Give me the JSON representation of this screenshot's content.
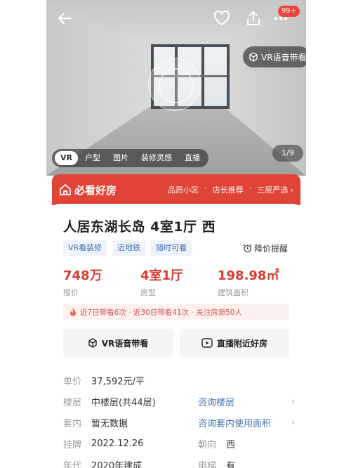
{
  "header": {
    "back_icon": "arrow-left-icon",
    "fav_icon": "heart-icon",
    "share_icon": "share-icon",
    "more_icon": "more-icon",
    "badge": "99+",
    "vr_voice": "VR语音带看",
    "tabs": [
      "VR",
      "户型",
      "图片",
      "装修灵感",
      "直播"
    ],
    "counter": "1/9"
  },
  "banner": {
    "brand": "必看好房",
    "tags": [
      "品质小区",
      "店长推荐",
      "三层严选 ›"
    ]
  },
  "listing": {
    "title": "人居东湖长岛 4室1厅 西",
    "chips": [
      "VR看装修",
      "近地铁",
      "随时可看"
    ],
    "price_alert": "降价提醒",
    "stats": [
      {
        "value": "748万",
        "label": "报价"
      },
      {
        "value": "4室1厅",
        "label": "房型"
      },
      {
        "value": "198.98㎡",
        "label": "建筑面积"
      }
    ],
    "hot": "近7日带看6次 · 近30日带看41次 · 关注房源50人",
    "actions": [
      "VR语音带看",
      "直播附近好房"
    ],
    "info": [
      {
        "k": "单价",
        "v": "37,592元/平",
        "k2": "",
        "v2": "",
        "link": false
      },
      {
        "k": "楼层",
        "v": "中楼层(共44层)",
        "k2": "",
        "v2": "咨询楼层",
        "link": true
      },
      {
        "k": "套内",
        "v": "暂无数据",
        "k2": "",
        "v2": "咨询套内使用面积",
        "link": true
      },
      {
        "k": "挂牌",
        "v": "2022.12.26",
        "k2": "朝向",
        "v2": "西",
        "link": false
      },
      {
        "k": "年代",
        "v": "2020年建成",
        "k2": "电梯",
        "v2": "有",
        "link": false
      }
    ]
  },
  "colors": {
    "accent": "#e04437",
    "link": "#3f6fb0"
  }
}
